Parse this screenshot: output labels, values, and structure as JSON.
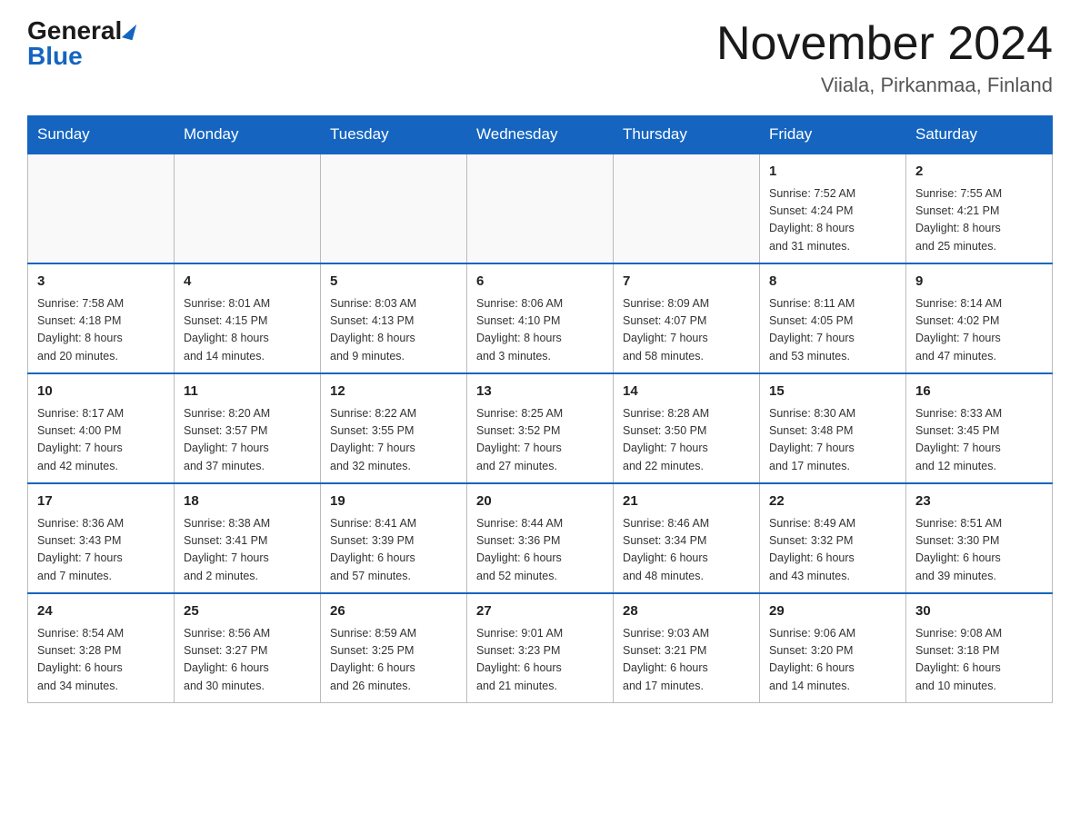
{
  "header": {
    "logo_general": "General",
    "logo_blue": "Blue",
    "month_title": "November 2024",
    "location": "Viiala, Pirkanmaa, Finland"
  },
  "days_of_week": [
    "Sunday",
    "Monday",
    "Tuesday",
    "Wednesday",
    "Thursday",
    "Friday",
    "Saturday"
  ],
  "weeks": [
    [
      {
        "day": "",
        "info": ""
      },
      {
        "day": "",
        "info": ""
      },
      {
        "day": "",
        "info": ""
      },
      {
        "day": "",
        "info": ""
      },
      {
        "day": "",
        "info": ""
      },
      {
        "day": "1",
        "info": "Sunrise: 7:52 AM\nSunset: 4:24 PM\nDaylight: 8 hours\nand 31 minutes."
      },
      {
        "day": "2",
        "info": "Sunrise: 7:55 AM\nSunset: 4:21 PM\nDaylight: 8 hours\nand 25 minutes."
      }
    ],
    [
      {
        "day": "3",
        "info": "Sunrise: 7:58 AM\nSunset: 4:18 PM\nDaylight: 8 hours\nand 20 minutes."
      },
      {
        "day": "4",
        "info": "Sunrise: 8:01 AM\nSunset: 4:15 PM\nDaylight: 8 hours\nand 14 minutes."
      },
      {
        "day": "5",
        "info": "Sunrise: 8:03 AM\nSunset: 4:13 PM\nDaylight: 8 hours\nand 9 minutes."
      },
      {
        "day": "6",
        "info": "Sunrise: 8:06 AM\nSunset: 4:10 PM\nDaylight: 8 hours\nand 3 minutes."
      },
      {
        "day": "7",
        "info": "Sunrise: 8:09 AM\nSunset: 4:07 PM\nDaylight: 7 hours\nand 58 minutes."
      },
      {
        "day": "8",
        "info": "Sunrise: 8:11 AM\nSunset: 4:05 PM\nDaylight: 7 hours\nand 53 minutes."
      },
      {
        "day": "9",
        "info": "Sunrise: 8:14 AM\nSunset: 4:02 PM\nDaylight: 7 hours\nand 47 minutes."
      }
    ],
    [
      {
        "day": "10",
        "info": "Sunrise: 8:17 AM\nSunset: 4:00 PM\nDaylight: 7 hours\nand 42 minutes."
      },
      {
        "day": "11",
        "info": "Sunrise: 8:20 AM\nSunset: 3:57 PM\nDaylight: 7 hours\nand 37 minutes."
      },
      {
        "day": "12",
        "info": "Sunrise: 8:22 AM\nSunset: 3:55 PM\nDaylight: 7 hours\nand 32 minutes."
      },
      {
        "day": "13",
        "info": "Sunrise: 8:25 AM\nSunset: 3:52 PM\nDaylight: 7 hours\nand 27 minutes."
      },
      {
        "day": "14",
        "info": "Sunrise: 8:28 AM\nSunset: 3:50 PM\nDaylight: 7 hours\nand 22 minutes."
      },
      {
        "day": "15",
        "info": "Sunrise: 8:30 AM\nSunset: 3:48 PM\nDaylight: 7 hours\nand 17 minutes."
      },
      {
        "day": "16",
        "info": "Sunrise: 8:33 AM\nSunset: 3:45 PM\nDaylight: 7 hours\nand 12 minutes."
      }
    ],
    [
      {
        "day": "17",
        "info": "Sunrise: 8:36 AM\nSunset: 3:43 PM\nDaylight: 7 hours\nand 7 minutes."
      },
      {
        "day": "18",
        "info": "Sunrise: 8:38 AM\nSunset: 3:41 PM\nDaylight: 7 hours\nand 2 minutes."
      },
      {
        "day": "19",
        "info": "Sunrise: 8:41 AM\nSunset: 3:39 PM\nDaylight: 6 hours\nand 57 minutes."
      },
      {
        "day": "20",
        "info": "Sunrise: 8:44 AM\nSunset: 3:36 PM\nDaylight: 6 hours\nand 52 minutes."
      },
      {
        "day": "21",
        "info": "Sunrise: 8:46 AM\nSunset: 3:34 PM\nDaylight: 6 hours\nand 48 minutes."
      },
      {
        "day": "22",
        "info": "Sunrise: 8:49 AM\nSunset: 3:32 PM\nDaylight: 6 hours\nand 43 minutes."
      },
      {
        "day": "23",
        "info": "Sunrise: 8:51 AM\nSunset: 3:30 PM\nDaylight: 6 hours\nand 39 minutes."
      }
    ],
    [
      {
        "day": "24",
        "info": "Sunrise: 8:54 AM\nSunset: 3:28 PM\nDaylight: 6 hours\nand 34 minutes."
      },
      {
        "day": "25",
        "info": "Sunrise: 8:56 AM\nSunset: 3:27 PM\nDaylight: 6 hours\nand 30 minutes."
      },
      {
        "day": "26",
        "info": "Sunrise: 8:59 AM\nSunset: 3:25 PM\nDaylight: 6 hours\nand 26 minutes."
      },
      {
        "day": "27",
        "info": "Sunrise: 9:01 AM\nSunset: 3:23 PM\nDaylight: 6 hours\nand 21 minutes."
      },
      {
        "day": "28",
        "info": "Sunrise: 9:03 AM\nSunset: 3:21 PM\nDaylight: 6 hours\nand 17 minutes."
      },
      {
        "day": "29",
        "info": "Sunrise: 9:06 AM\nSunset: 3:20 PM\nDaylight: 6 hours\nand 14 minutes."
      },
      {
        "day": "30",
        "info": "Sunrise: 9:08 AM\nSunset: 3:18 PM\nDaylight: 6 hours\nand 10 minutes."
      }
    ]
  ]
}
